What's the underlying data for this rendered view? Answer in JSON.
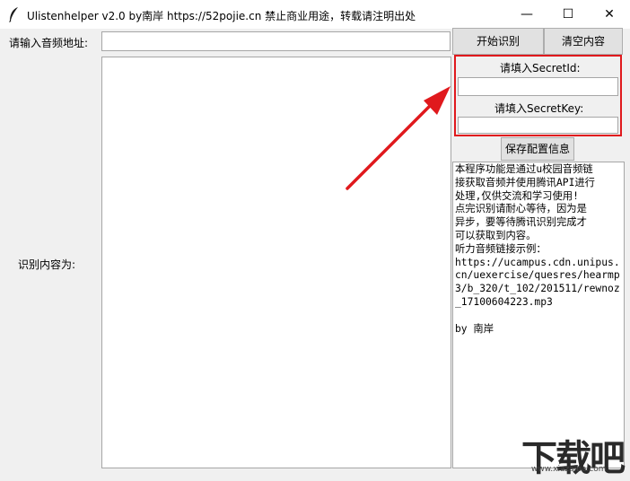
{
  "window": {
    "title": "Ulistenhelper v2.0 by南岸 https://52pojie.cn 禁止商业用途，转载请注明出处",
    "minimize_glyph": "—",
    "maximize_glyph": "☐",
    "close_glyph": "✕"
  },
  "form": {
    "url_label": "请输入音频地址:",
    "url_value": "",
    "result_label": "识别内容为:",
    "result_value": ""
  },
  "buttons": {
    "start": "开始识别",
    "clear": "清空内容",
    "save": "保存配置信息"
  },
  "credentials": {
    "secret_id_label": "请填入SecretId:",
    "secret_id_value": "",
    "secret_key_label": "请填入SecretKey:",
    "secret_key_value": ""
  },
  "info_lines": [
    "本程序功能是通过u校园音频链",
    "接获取音频并使用腾讯API进行",
    "处理,仅供交流和学习使用!",
    "点完识别请耐心等待，因为是",
    "异步，要等待腾讯识别完成才",
    "可以获取到内容。",
    "听力音频链接示例：",
    "https://ucampus.cdn.unipus.",
    "cn/uexercise/quesres/hearmp",
    "3/b_320/t_102/201511/rewnoz",
    "_17100604223.mp3",
    "",
    "by 南岸"
  ],
  "watermark": {
    "text": "下载吧",
    "url": "www.xiazaiba.com"
  },
  "colors": {
    "annotation_red": "#e0191d"
  }
}
